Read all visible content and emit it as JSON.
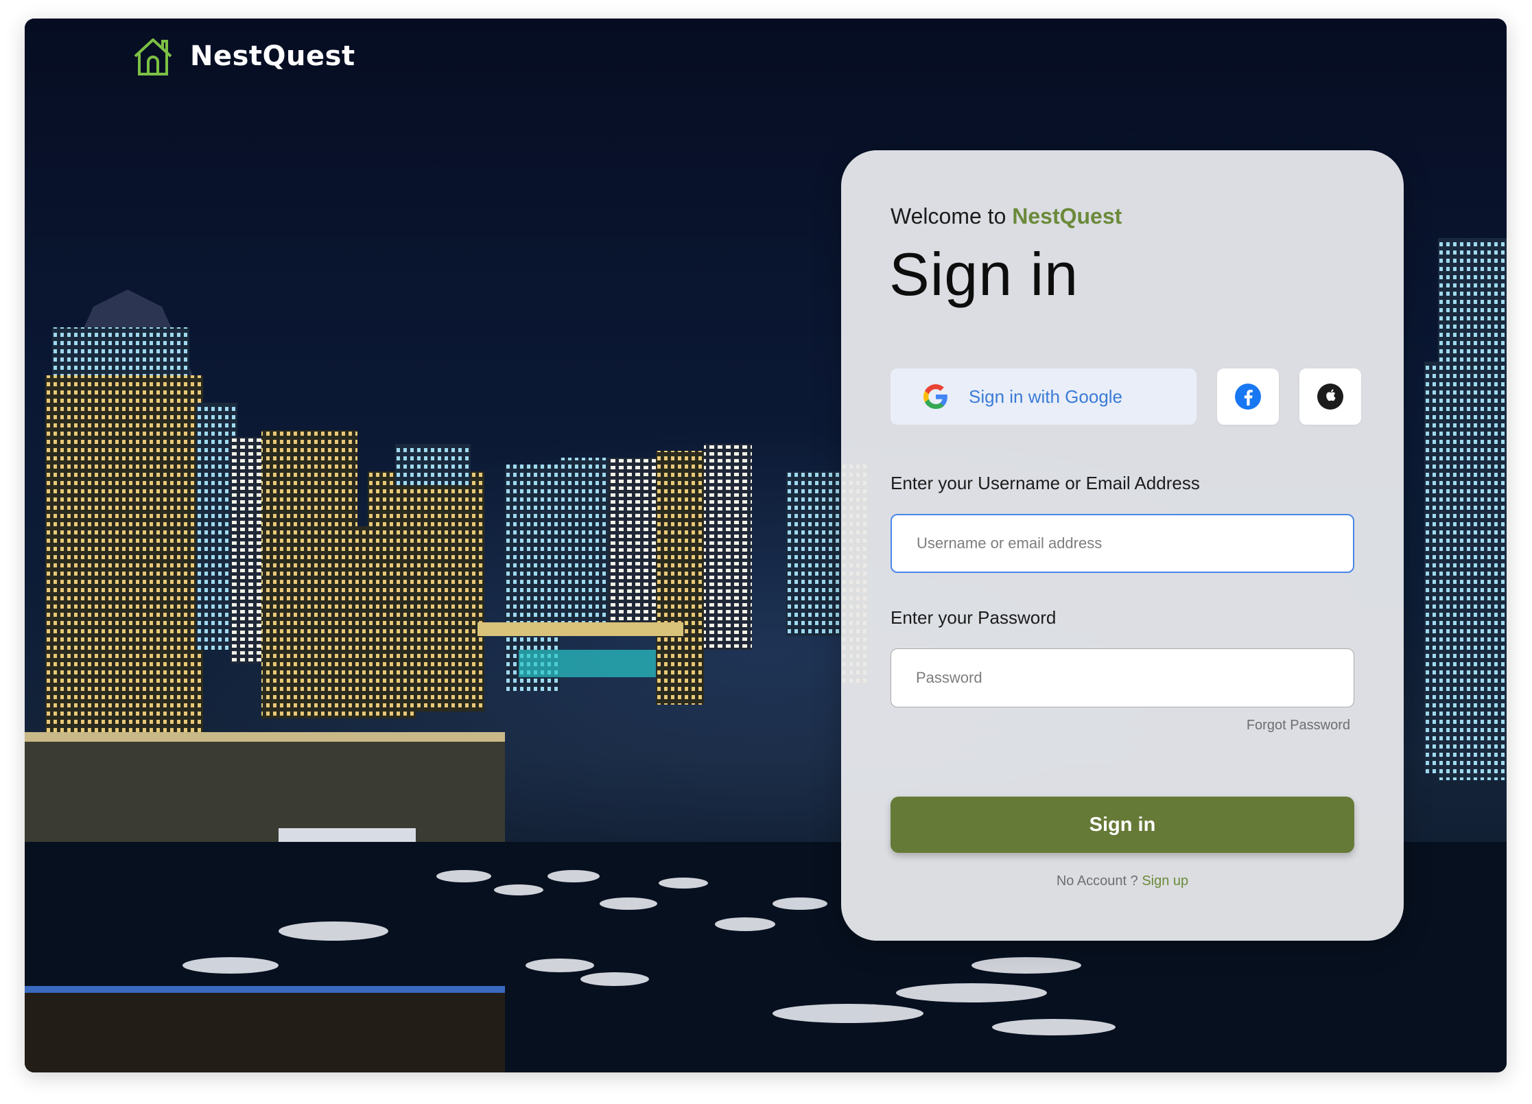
{
  "brand": {
    "name": "NestQuest",
    "accent_color": "#6b8a3a"
  },
  "card": {
    "welcome_prefix": "Welcome to",
    "welcome_brand": "NestQuest",
    "title": "Sign in",
    "google_label": "Sign in with Google",
    "username_label": "Enter your Username or Email Address",
    "username_placeholder": "Username or email address",
    "password_label": "Enter your Password",
    "password_placeholder": "Password",
    "forgot_label": "Forgot Password",
    "submit_label": "Sign in",
    "no_account_label": "No Account ?",
    "signup_label": "Sign up"
  },
  "social": {
    "google_icon": "google-icon",
    "facebook_icon": "facebook-icon",
    "apple_icon": "apple-icon"
  },
  "colors": {
    "primary_button": "#667a37",
    "focus_border": "#4a86e8",
    "google_text": "#3b7bd6"
  }
}
